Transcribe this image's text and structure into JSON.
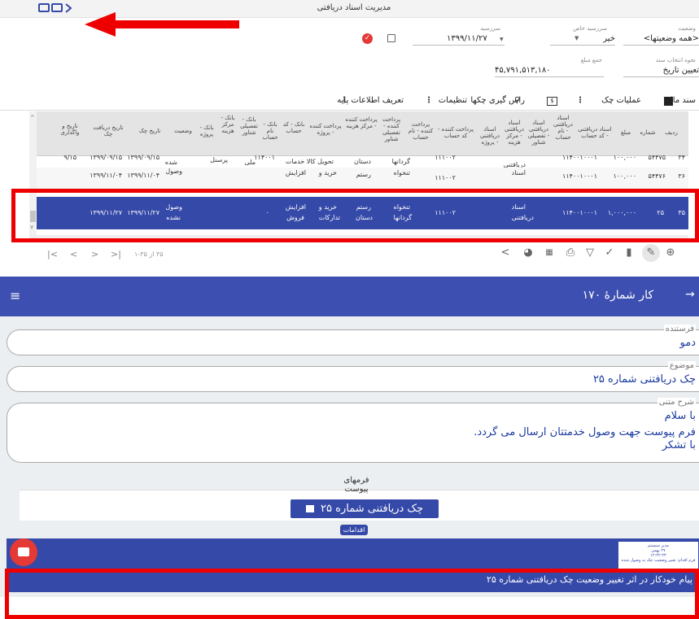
{
  "top": {
    "window_title": "مدیریت اسناد دریافتی",
    "filters": {
      "status_label": "وضعیت",
      "status_value": "<همه وضعیتها>",
      "due_special_label": "سررسید خاص",
      "due_special_value": "خیر",
      "due_label": "سررسید",
      "due_value": "۱۳۹۹/۱۱/۲۷",
      "doc_select_label": "نحوه انتخاب سند",
      "doc_select_value": "تعیین تاریخ",
      "sum_label": "جمع مبلغ",
      "sum_value": "۴۵,۷۹۱,۵۱۳,۱۸۰"
    },
    "toolbar": {
      "financial_doc": "سند مالی",
      "check_ops": "عملیات چک",
      "due_checks": "راس گیری چکها",
      "settings": "تنظیمات",
      "base_info": "تعریف اطلاعات پایه"
    },
    "columns": [
      "ردیف",
      "شماره",
      "مبلغ",
      "اسناد دریافتنی - کد حساب",
      "اسناد دریافتنی - نام حساب",
      "اسناد دریافتنی - تفصیلی شناور",
      "اسناد دریافتنی - مرکز هزینه",
      "اسناد دریافتنی - پروژه",
      "پرداخت کننده - کد حساب",
      "پرداخت کننده - نام حساب",
      "پرداخت کننده - تفصیلی شناور",
      "پرداخت کننده - مرکز هزینه",
      "پرداخت کننده - پروژه",
      "بانک - کد حساب",
      "بانک - نام حساب",
      "بانک - تفصیلی شناور",
      "بانک - مرکز هزینه",
      "بانک - پروژه",
      "وضعیت",
      "تاریخ چک",
      "تاریخ دریافت چک",
      "تاریخ و واگذاری"
    ],
    "rows": [
      {
        "radif": "۳۴",
        "number": "۵۴۴۷۵",
        "amount": "۱۰۰,۰۰۰",
        "recv_code": "۱۱۴۰۰۱۰۰۰۱",
        "recv_name": "دریافتنی",
        "payer_code": "۱۱۱۰۰۲",
        "payer_name": "گردانها",
        "payer_float": "دستان",
        "payer_cost": "تحویل کالا خدمات",
        "bank_code": "۱۱۴۰۰۱",
        "bank_name": "ملی",
        "bank_float": "پرسنل",
        "status": "شده",
        "check_date": "۱۳۹۹/۰۹/۱۵",
        "recv_date": "۱۳۹۹/۰۹/۱۵",
        "assign_date": "۹/۱۵"
      },
      {
        "radif": "۳۶",
        "number": "۵۴۴۷۶",
        "amount": "۱۰۰,۰۰۰",
        "recv_code": "۱۱۴۰۰۱۰۰۰۱",
        "recv_name": "اسناد",
        "payer_code": "۱۱۱۰۰۲",
        "payer_name": "تنخواه",
        "payer_float": "رستم",
        "payer_cost": "خرید و",
        "payer_project": "افزایش",
        "status": "وصول",
        "check_date": "۱۳۹۹/۱۱/۰۴",
        "recv_date": "۱۳۹۹/۱۱/۰۴"
      },
      {
        "radif": "۳۵",
        "number": "۲۵",
        "amount": "۱,۰۰۰,۰۰۰",
        "recv_code": "۱۱۴۰۰۱۰۰۰۱",
        "recv_name_1": "اسناد",
        "recv_name_2": "دریافتنی",
        "payer_code": "۱۱۱۰۰۲",
        "payer_name_1": "تنخواه",
        "payer_name_2": "گردانها",
        "payer_float_1": "رستم",
        "payer_float_2": "دستان",
        "payer_cost_1": "خرید و",
        "payer_cost_2": "تدارکات",
        "payer_project_1": "افزایش",
        "payer_project_2": "فروش",
        "bank_dot": ".",
        "status_1": "وصول",
        "status_2": "نشده",
        "check_date": "۱۳۹۹/۱۱/۲۷",
        "recv_date": "۱۳۹۹/۱۱/۲۷"
      }
    ],
    "pager_text": "۳۵ از ۳۵-۱"
  },
  "bottom": {
    "app_title": "کار شمارهٔ ۱۷۰",
    "sender": {
      "legend": "فرستنده",
      "value": "دمو"
    },
    "subject": {
      "legend": "موضوع",
      "value": "چک دریافتنی شماره ۲۵"
    },
    "body": {
      "legend": "شرح متنی",
      "line1": "با سلام",
      "line2": "فرم پیوست  جهت وصول خدمتتان ارسال می گردد.",
      "line3": "با تشکر"
    },
    "attachments_label": "فرمهای پیوست",
    "attachment_button": "چک دریافتنی شماره ۲۵",
    "actions_label": "اقدامات",
    "note": {
      "user": "مدیر سیستم",
      "date": "۲۷ بهمن",
      "time": "۱۲:۲۲:۲۳",
      "action": "فرم اقدام: تغییر وضعیت چک به وصول شده"
    },
    "banner_text": "پیام خودکار در اثر تغییر وضعیت چک دریافتنی شماره ۲۵"
  },
  "colors": {
    "primary": "#3549a8",
    "appbar": "#3d4fb0",
    "highlight": "#e00000",
    "fab": "#e53935"
  }
}
